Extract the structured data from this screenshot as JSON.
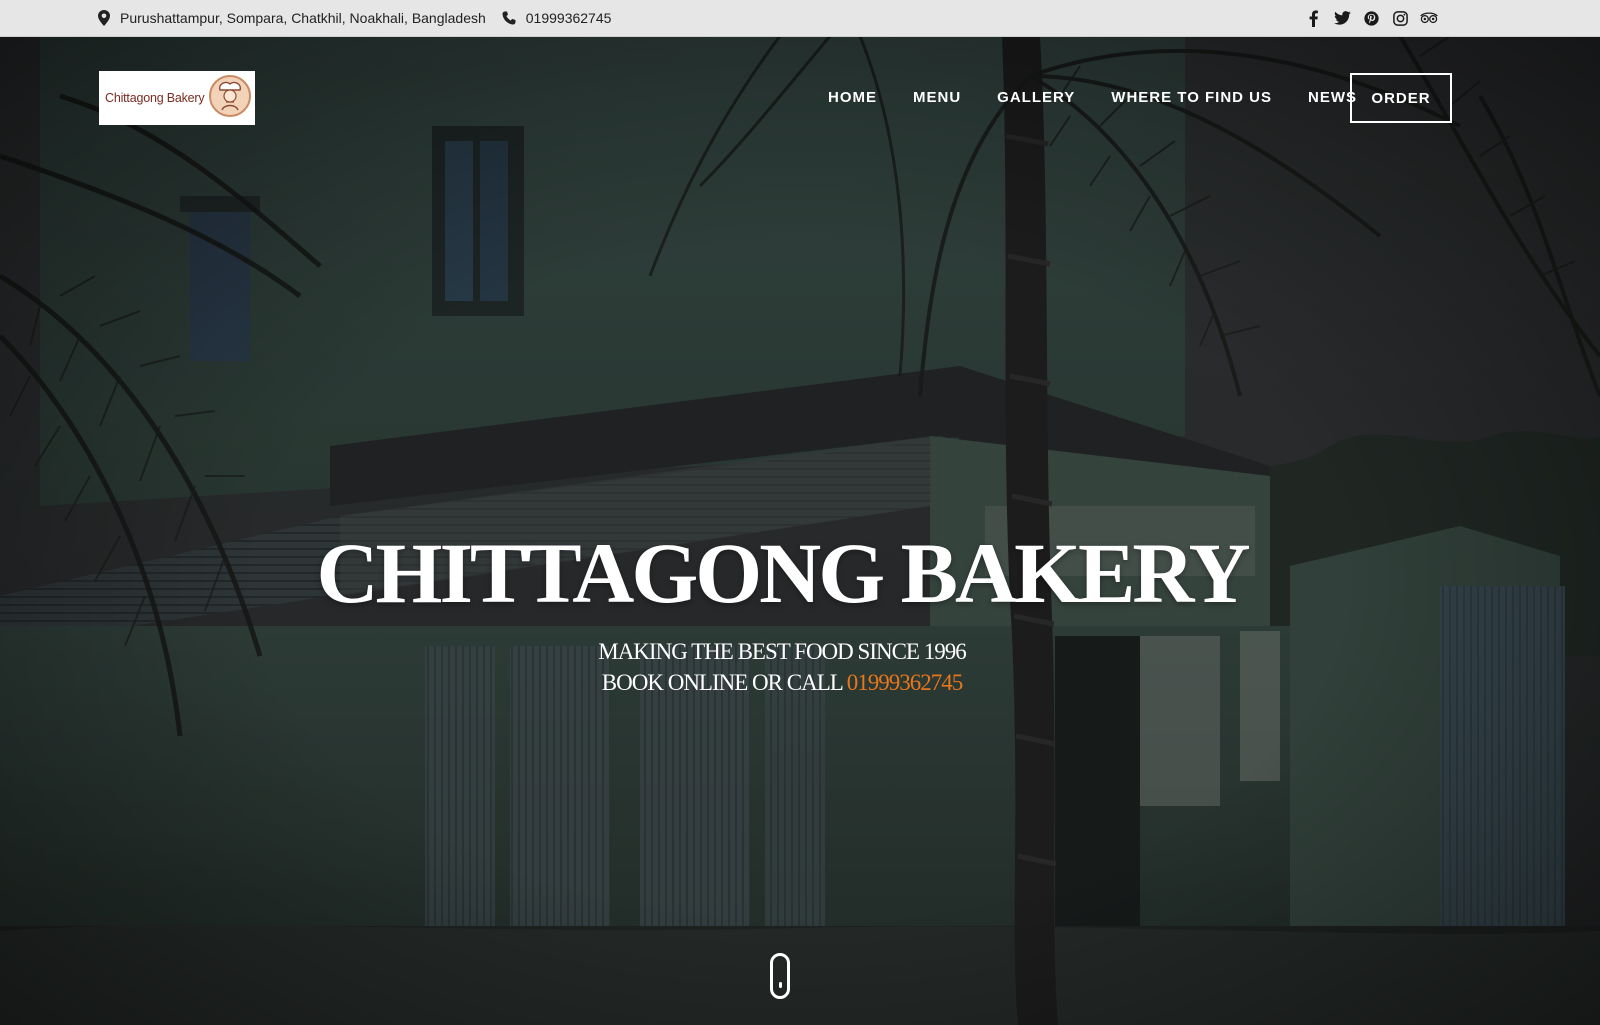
{
  "topbar": {
    "address": "Purushattampur, Sompara, Chatkhil, Noakhali, Bangladesh",
    "phone": "01999362745",
    "icons": {
      "address": "map-pin-icon",
      "phone": "phone-icon"
    },
    "social": [
      "facebook-icon",
      "twitter-icon",
      "pinterest-icon",
      "instagram-icon",
      "tripadvisor-icon"
    ]
  },
  "header": {
    "logo_text": "Chittagong Bakery",
    "nav": {
      "home": "HOME",
      "menu": "MENU",
      "gallery": "GALLERY",
      "where": "WHERE TO FIND US",
      "news": "NEWS"
    },
    "order": "ORDER"
  },
  "hero": {
    "title": "CHITTAGONG BAKERY",
    "line1": "MAKING THE BEST FOOD SINCE 1996",
    "line2_prefix": "BOOK ONLINE OR CALL ",
    "line2_phone": "01999362745"
  },
  "colors": {
    "accent": "#e8761a",
    "topbar_bg": "#e6e6e6",
    "text_light": "#ffffff"
  }
}
